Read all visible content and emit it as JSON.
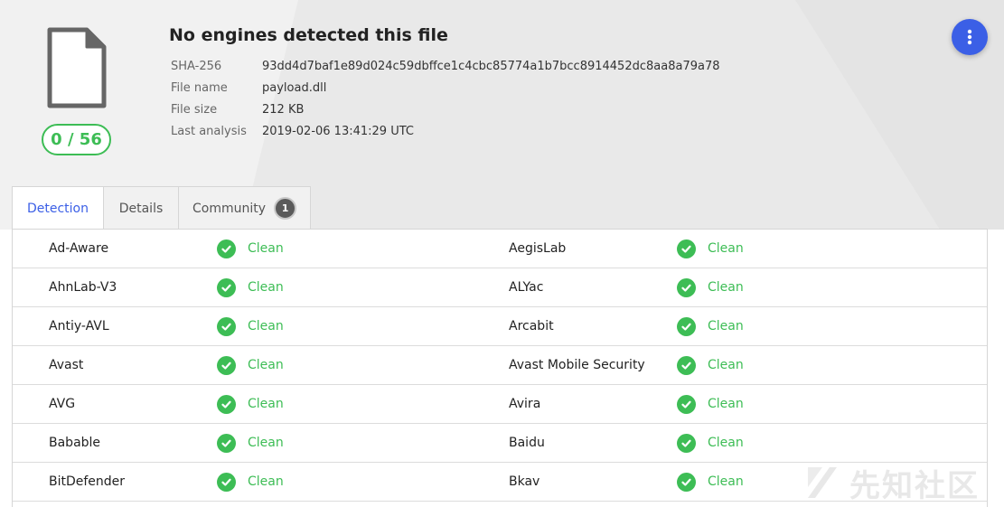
{
  "file": {
    "title": "No engines detected this file",
    "score": "0 / 56",
    "icon": "file-icon",
    "meta": [
      {
        "label": "SHA-256",
        "value": "93dd4d7baf1e89d024c59dbffce1c4cbc85774a1b7bcc8914452dc8aa8a79a78"
      },
      {
        "label": "File name",
        "value": "payload.dll"
      },
      {
        "label": "File size",
        "value": "212 KB"
      },
      {
        "label": "Last analysis",
        "value": "2019-02-06 13:41:29 UTC"
      }
    ]
  },
  "menu": {
    "icon": "more-vertical-icon"
  },
  "tabs": [
    {
      "label": "Detection",
      "active": true
    },
    {
      "label": "Details",
      "active": false
    },
    {
      "label": "Community",
      "active": false,
      "badge": "1"
    }
  ],
  "detections": [
    {
      "left": {
        "engine": "Ad-Aware",
        "result": "Clean"
      },
      "right": {
        "engine": "AegisLab",
        "result": "Clean"
      }
    },
    {
      "left": {
        "engine": "AhnLab-V3",
        "result": "Clean"
      },
      "right": {
        "engine": "ALYac",
        "result": "Clean"
      }
    },
    {
      "left": {
        "engine": "Antiy-AVL",
        "result": "Clean"
      },
      "right": {
        "engine": "Arcabit",
        "result": "Clean"
      }
    },
    {
      "left": {
        "engine": "Avast",
        "result": "Clean"
      },
      "right": {
        "engine": "Avast Mobile Security",
        "result": "Clean"
      }
    },
    {
      "left": {
        "engine": "AVG",
        "result": "Clean"
      },
      "right": {
        "engine": "Avira",
        "result": "Clean"
      }
    },
    {
      "left": {
        "engine": "Babable",
        "result": "Clean"
      },
      "right": {
        "engine": "Baidu",
        "result": "Clean"
      }
    },
    {
      "left": {
        "engine": "BitDefender",
        "result": "Clean"
      },
      "right": {
        "engine": "Bkav",
        "result": "Clean"
      }
    }
  ],
  "watermark": "先知社区",
  "colors": {
    "accent": "#3b5fe6",
    "clean": "#3dbd55",
    "header_bg": "#f1f1f1"
  }
}
